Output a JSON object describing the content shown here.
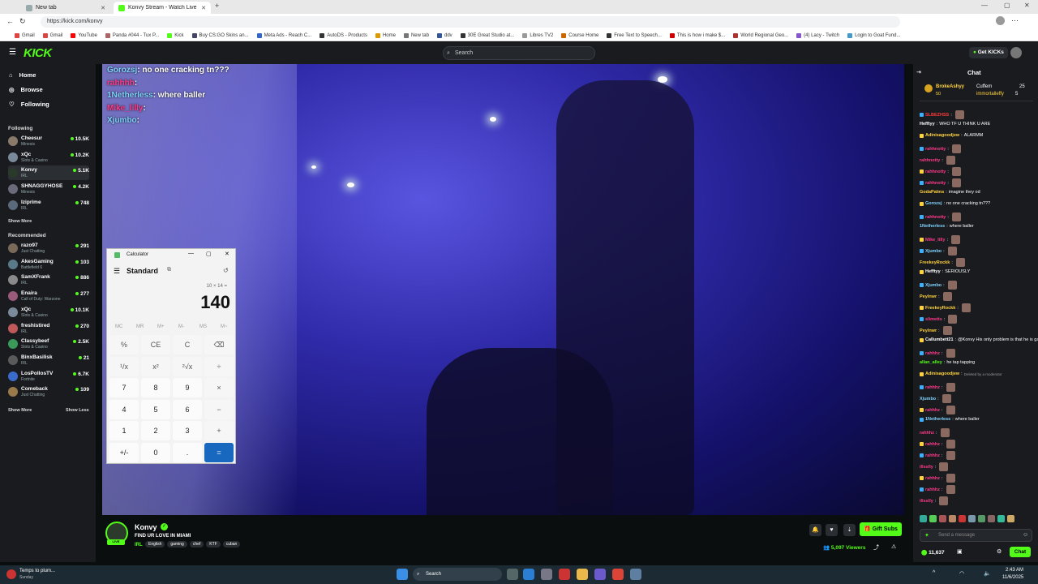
{
  "browser": {
    "tabs": [
      {
        "label": "New tab",
        "active": false
      },
      {
        "label": "Konvy Stream - Watch Live on Kick",
        "active": true
      }
    ],
    "url": "https://kick.com/konvy",
    "bookmarks": [
      "Gmail",
      "Gmail",
      "YouTube",
      "Panda #044 - Tux P...",
      "Kick",
      "Buy CS:GO Skins an...",
      "Meta Ads - Reach C...",
      "AutoDS - Products",
      "Home",
      "New tab",
      "ddv",
      "30E Great Studio at...",
      "Libres TV2",
      "Course Home",
      "Free Text to Speech...",
      "This is how i make $...",
      "World Regional Geo...",
      "(4) Lacy - Twitch",
      "Login to Goat Fund..."
    ]
  },
  "kick": {
    "logo": "KICK",
    "search_placeholder": "Search",
    "get_kicks": "Get KICKs"
  },
  "sidebar": {
    "nav": [
      {
        "label": "Home",
        "icon": "home-icon"
      },
      {
        "label": "Browse",
        "icon": "compass-icon"
      },
      {
        "label": "Following",
        "icon": "heart-icon"
      }
    ],
    "following_title": "Following",
    "following": [
      {
        "name": "Cheesur",
        "game": "Minesis",
        "viewers": "10.5K",
        "color": "#8a7a6a"
      },
      {
        "name": "xQc",
        "game": "Slots & Casino",
        "viewers": "10.2K",
        "color": "#7a8a9a"
      },
      {
        "name": "Konvy",
        "game": "IRL",
        "viewers": "5.1K",
        "color": "#2a3a2a",
        "selected": true
      },
      {
        "name": "SHNAGGYHOSE",
        "game": "Minesis",
        "viewers": "4.2K",
        "color": "#6a6a7a"
      },
      {
        "name": "Iziprime",
        "game": "IRL",
        "viewers": "748",
        "color": "#5a6a7a"
      }
    ],
    "show_more_1": "Show More",
    "recommended_title": "Recommended",
    "recommended": [
      {
        "name": "razo97",
        "game": "Just Chatting",
        "viewers": "291",
        "color": "#7a6a5a"
      },
      {
        "name": "AkesGaming",
        "game": "Battlefield 6",
        "viewers": "103",
        "color": "#5a7a8a"
      },
      {
        "name": "SamXFrank",
        "game": "IRL",
        "viewers": "886",
        "color": "#8a8a8a"
      },
      {
        "name": "Enaira",
        "game": "Call of Duty: Warzone",
        "viewers": "277",
        "color": "#9a5a7a"
      },
      {
        "name": "xQc",
        "game": "Slots & Casino",
        "viewers": "10.1K",
        "color": "#7a8a9a"
      },
      {
        "name": "freshistired",
        "game": "IRL",
        "viewers": "270",
        "color": "#c05a5a"
      },
      {
        "name": "Classybeef",
        "game": "Slots & Casino",
        "viewers": "2.5K",
        "color": "#3a9a5a"
      },
      {
        "name": "BinxBasilisk",
        "game": "IRL",
        "viewers": "21",
        "color": "#5a5a5a"
      },
      {
        "name": "LosPollosTV",
        "game": "Fortnite",
        "viewers": "6.7K",
        "color": "#3a6aca"
      },
      {
        "name": "Comeback",
        "game": "Just Chatting",
        "viewers": "109",
        "color": "#9a7a4a"
      }
    ],
    "show_more_2": "Show More",
    "show_less": "Show Less"
  },
  "video_overlay": [
    {
      "user": "Gorozsj",
      "text": ": no one cracking tn???",
      "color": "#7fd3ff"
    },
    {
      "user": "rahhhh",
      "text": ": ",
      "color": "#ff3b8a"
    },
    {
      "user": "1Netherless",
      "text": ": where baller",
      "color": "#7fd3ff"
    },
    {
      "user": "Mike_lilly",
      "text": ": ",
      "color": "#ff3b8a"
    },
    {
      "user": "Xjumbo",
      "text": ": ",
      "color": "#7fd3ff"
    }
  ],
  "calculator": {
    "title": "Calculator",
    "mode": "Standard",
    "expression": "10 × 14 =",
    "display": "140",
    "memory": [
      "MC",
      "MR",
      "M+",
      "M-",
      "MS",
      "M~"
    ],
    "keys": [
      [
        "%",
        "CE",
        "C",
        "⌫"
      ],
      [
        "¹/x",
        "x²",
        "²√x",
        "÷"
      ],
      [
        "7",
        "8",
        "9",
        "×"
      ],
      [
        "4",
        "5",
        "6",
        "−"
      ],
      [
        "1",
        "2",
        "3",
        "+"
      ],
      [
        "+/-",
        "0",
        ".",
        "="
      ]
    ]
  },
  "stream": {
    "streamer": "Konvy",
    "title": "FIND UR LOVE IN MIAMI",
    "category": "IRL",
    "tags": [
      "English",
      "gaming",
      "chef",
      "KTF",
      "cuban"
    ],
    "viewers": "5,097 Viewers",
    "gift_subs": "Gift Subs"
  },
  "chat": {
    "title": "Chat",
    "pinned_user": "BrokeAshyy",
    "pinned_amount": "50",
    "pinned_user2": "Cuffem",
    "pinned_user3": "immortalleffy",
    "pinned_num1": "25",
    "pinned_num2": "5",
    "messages": [
      {
        "user": "SLBEZHSS",
        "text": "",
        "color": "#ff3b3b",
        "emote": true
      },
      {
        "user": "Hefftyy",
        "text": "WHO TF U THINK U ARE",
        "color": "#ffffff"
      },
      {
        "user": "Adinisagoodjew",
        "text": "ALARMM",
        "color": "#ffd23b"
      },
      {
        "user": "rahhnotty",
        "text": "",
        "color": "#ff3b8a",
        "emote": true
      },
      {
        "user": "rahhnotty",
        "text": "",
        "color": "#ff3b8a",
        "emote": true
      },
      {
        "user": "rahhnotty",
        "text": "",
        "color": "#ff3b8a",
        "emote": true
      },
      {
        "user": "rahhnotty",
        "text": "",
        "color": "#ff3b8a",
        "emote": true
      },
      {
        "user": "GodaPalms",
        "text": "imagine they od",
        "color": "#ffd23b"
      },
      {
        "user": "Gorozsj",
        "text": "no one cracking tn???",
        "color": "#7fd3ff"
      },
      {
        "user": "rahhnotty",
        "text": "",
        "color": "#ff3b8a",
        "emote": true
      },
      {
        "user": "1Netherless",
        "text": "where baller",
        "color": "#7fd3ff"
      },
      {
        "user": "Mike_lilly",
        "text": "",
        "color": "#ff3b8a",
        "emote": true
      },
      {
        "user": "Xjumbo",
        "text": "",
        "color": "#7fd3ff",
        "emote": true
      },
      {
        "user": "FreekeyRockk",
        "text": "",
        "color": "#ffd23b",
        "emote": true
      },
      {
        "user": "Hefftyy",
        "text": "SERIOUSLY",
        "color": "#ffffff"
      },
      {
        "user": "Xjumbo",
        "text": "",
        "color": "#7fd3ff",
        "emote": true
      },
      {
        "user": "Peylnwr",
        "text": "",
        "color": "#ffd23b",
        "emote": true
      },
      {
        "user": "FreekeyRockk",
        "text": "",
        "color": "#ffd23b",
        "emote": true
      },
      {
        "user": "slimetts",
        "text": "",
        "color": "#ff3b8a",
        "emote": true
      },
      {
        "user": "Peylnwr",
        "text": "",
        "color": "#ffd23b",
        "emote": true
      },
      {
        "user": "Callumbett21",
        "text": "@Konvy His only problem is that he is gay",
        "color": "#ffffff"
      },
      {
        "user": "rahhhz",
        "text": "",
        "color": "#ff3b8a",
        "emote": true
      },
      {
        "user": "allan_alley",
        "text": "he tap tapping",
        "color": "#53fc18"
      },
      {
        "user": "Adinisagoodjew",
        "text": "Deleted by a moderator",
        "color": "#ffd23b"
      },
      {
        "user": "rahhhz",
        "text": "",
        "color": "#ff3b8a",
        "emote": true
      },
      {
        "user": "Xjumbo",
        "text": "",
        "color": "#7fd3ff",
        "emote": true
      },
      {
        "user": "rahhhz",
        "text": "",
        "color": "#ff3b8a",
        "emote": true
      },
      {
        "user": "1Netherless",
        "text": "where baller",
        "color": "#7fd3ff"
      },
      {
        "user": "rahhhz",
        "text": "",
        "color": "#ff3b8a",
        "emote": true
      },
      {
        "user": "rahhhz",
        "text": "",
        "color": "#ff3b8a",
        "emote": true
      },
      {
        "user": "rahhhz",
        "text": "",
        "color": "#ff3b8a",
        "emote": true
      },
      {
        "user": "illsslly",
        "text": "",
        "color": "#ff3b8a",
        "emote": true
      },
      {
        "user": "rahhhz",
        "text": "",
        "color": "#ff3b8a",
        "emote": true
      },
      {
        "user": "rahhhz",
        "text": "",
        "color": "#ff3b8a",
        "emote": true
      },
      {
        "user": "illsslly",
        "text": "",
        "color": "#ff3b8a",
        "emote": true
      }
    ],
    "input_placeholder": "Send a message",
    "kicks_count": "11,637",
    "chat_button": "Chat"
  },
  "taskbar": {
    "weather": "Temps to plum...",
    "weather_sub": "Sunday",
    "search": "Search",
    "time": "2:43 AM",
    "date": "11/6/2025"
  },
  "colors": {
    "accent": "#53fc18",
    "bg": "#191b1f",
    "windows_blue": "#1868c0"
  }
}
